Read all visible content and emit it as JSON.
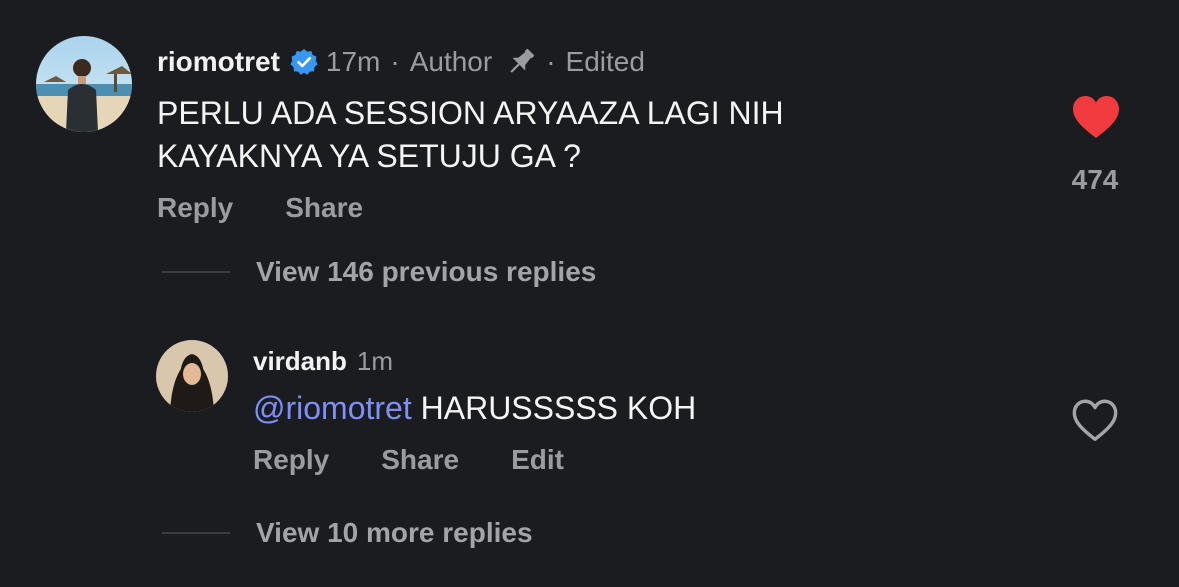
{
  "comment": {
    "username": "riomotret",
    "verified_icon": "verified-badge-icon",
    "time": "17m",
    "separator": "·",
    "author_label": "Author",
    "pin_icon": "pin-icon",
    "edited_label": "Edited",
    "text": "PERLU ADA SESSION ARYAAZA LAGI NIH KAYAKNYA YA SETUJU GA ?",
    "reply_label": "Reply",
    "share_label": "Share",
    "liked": true,
    "like_icon": "heart-filled-icon",
    "like_color": "#f23b3f",
    "like_count": "474"
  },
  "view_previous": "View 146 previous replies",
  "reply": {
    "username": "virdanb",
    "time": "1m",
    "mention": "@riomotret",
    "text": " HARUSSSSS KOH",
    "mention_color": "#7f8ff7",
    "reply_label": "Reply",
    "share_label": "Share",
    "edit_label": "Edit",
    "liked": false,
    "like_icon": "heart-outline-icon"
  },
  "view_more": "View 10 more replies",
  "colors": {
    "background": "#1b1c20",
    "verified_blue": "#3897f0",
    "muted_text": "#9a9ca1"
  }
}
